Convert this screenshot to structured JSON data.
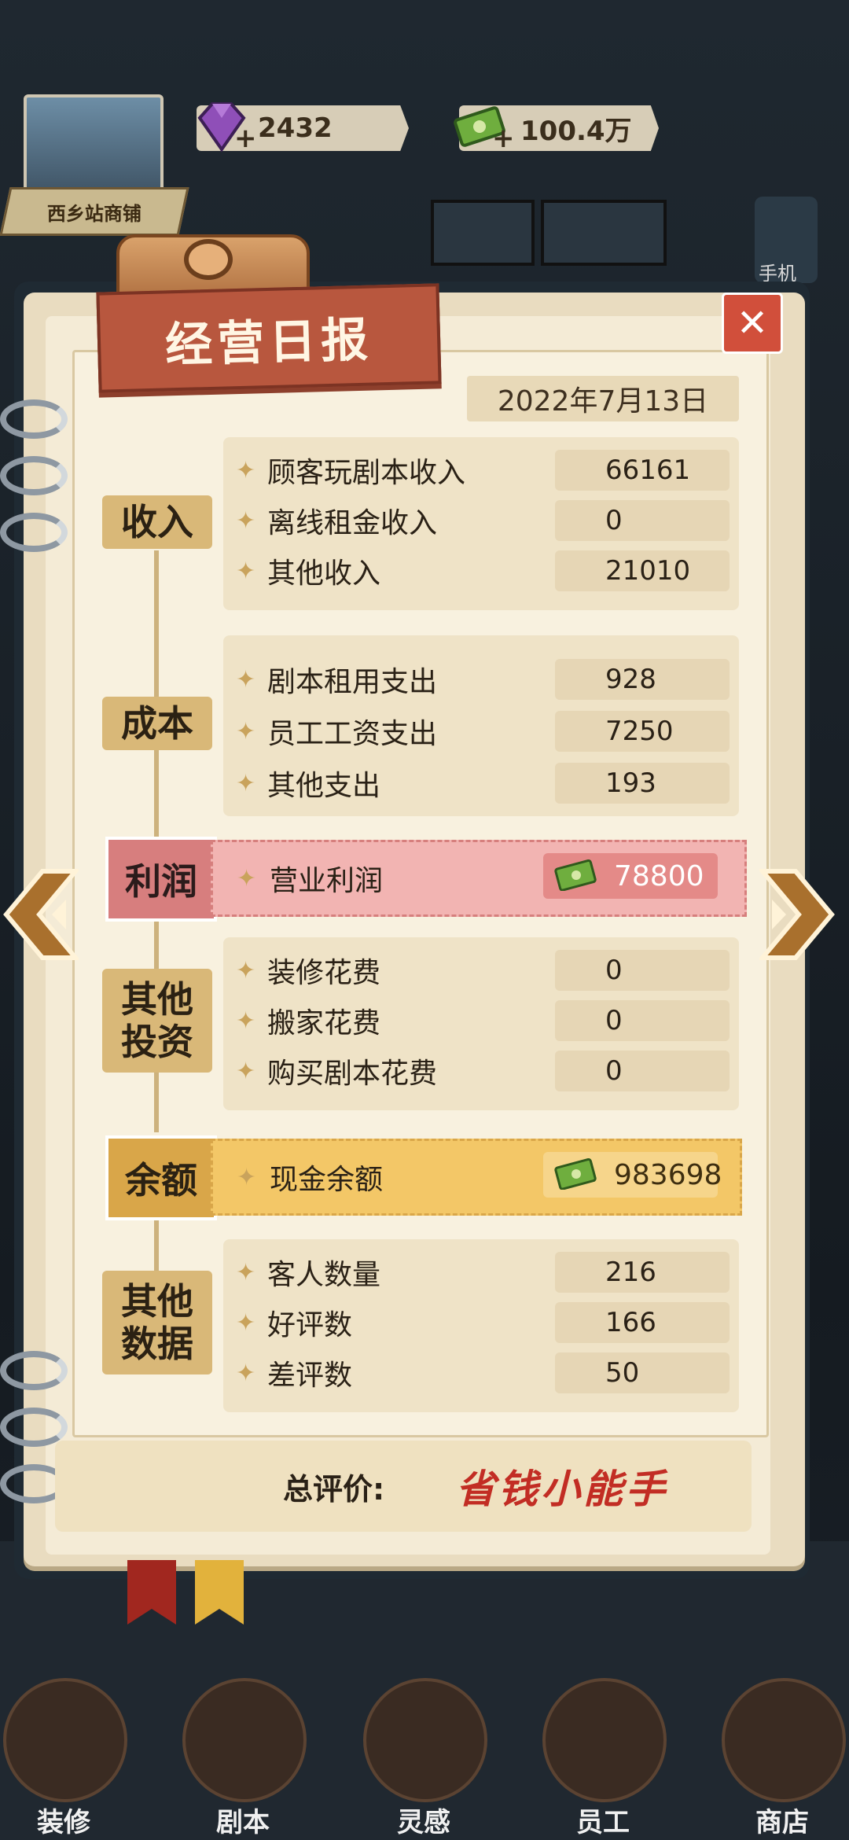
{
  "hud": {
    "shop_name": "西乡站商铺",
    "gems": "2432",
    "cash": "100.4万",
    "phone_label": "手机"
  },
  "report": {
    "title": "经营日报",
    "close": "✕",
    "date": "2022年7月13日",
    "sections": {
      "income": {
        "label": "收入",
        "rows": [
          {
            "label": "顾客玩剧本收入",
            "value": "66161"
          },
          {
            "label": "离线租金收入",
            "value": "0"
          },
          {
            "label": "其他收入",
            "value": "21010"
          }
        ]
      },
      "cost": {
        "label": "成本",
        "rows": [
          {
            "label": "剧本租用支出",
            "value": "928"
          },
          {
            "label": "员工工资支出",
            "value": "7250"
          },
          {
            "label": "其他支出",
            "value": "193"
          }
        ]
      },
      "profit": {
        "label": "利润",
        "item": "营业利润",
        "value": "78800"
      },
      "invest": {
        "label_line1": "其他",
        "label_line2": "投资",
        "rows": [
          {
            "label": "装修花费",
            "value": "0"
          },
          {
            "label": "搬家花费",
            "value": "0"
          },
          {
            "label": "购买剧本花费",
            "value": "0"
          }
        ]
      },
      "balance": {
        "label": "余额",
        "item": "现金余额",
        "value": "983698"
      },
      "other": {
        "label_line1": "其他",
        "label_line2": "数据",
        "rows": [
          {
            "label": "客人数量",
            "value": "216"
          },
          {
            "label": "好评数",
            "value": "166"
          },
          {
            "label": "差评数",
            "value": "50"
          }
        ]
      }
    },
    "rating_label": "总评价:",
    "rating_value": "省钱小能手"
  },
  "bottom_nav": [
    {
      "label": "装修",
      "icon": "house-icon"
    },
    {
      "label": "剧本",
      "icon": "script-book-icon"
    },
    {
      "label": "灵感",
      "icon": "lightbulb-icon"
    },
    {
      "label": "员工",
      "icon": "staff-card-icon"
    },
    {
      "label": "商店",
      "icon": "shop-icon"
    }
  ],
  "colors": {
    "profit": "#f2b4b2",
    "balance": "#f3c767",
    "rating": "#c22d24",
    "title_banner": "#b8573e"
  }
}
